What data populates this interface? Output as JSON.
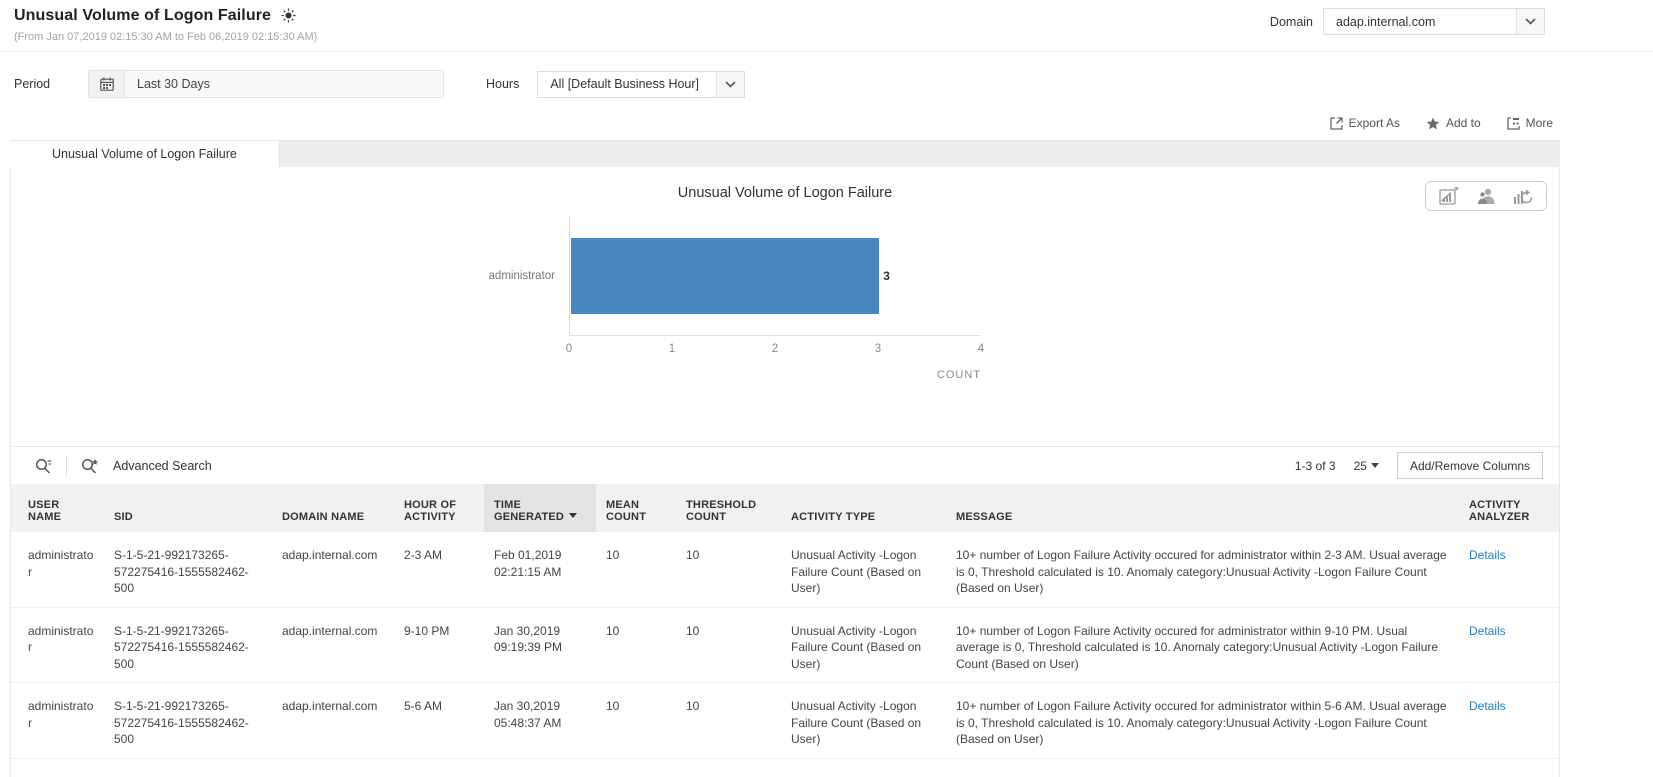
{
  "header": {
    "title": "Unusual Volume of Logon Failure",
    "subtitle": "(From Jan 07,2019 02:15:30 AM to Feb 06,2019 02:15:30 AM)",
    "domain_label": "Domain",
    "domain_value": "adap.internal.com"
  },
  "filters": {
    "period_label": "Period",
    "period_value": "Last 30 Days",
    "hours_label": "Hours",
    "hours_value": "All [Default Business Hour]"
  },
  "toolbar": {
    "export_label": "Export As",
    "add_to_label": "Add to",
    "more_label": "More"
  },
  "tabs": [
    {
      "label": "Unusual Volume of Logon Failure",
      "active": true
    }
  ],
  "chart_data": {
    "type": "bar",
    "orientation": "horizontal",
    "title": "Unusual Volume of Logon Failure",
    "categories": [
      "administrator"
    ],
    "values": [
      3
    ],
    "value_labels": [
      "3"
    ],
    "xlabel": "COUNT",
    "ylabel": "",
    "xlim": [
      0,
      4
    ],
    "xticks": [
      0,
      1,
      2,
      3,
      4
    ],
    "bar_color": "#4a86be",
    "legend": false,
    "grid": false
  },
  "table_toolbar": {
    "advanced_search_label": "Advanced Search",
    "pagination": "1-3 of 3",
    "page_size": "25",
    "add_remove_columns_label": "Add/Remove Columns"
  },
  "table": {
    "columns": [
      "USER NAME",
      "SID",
      "DOMAIN NAME",
      "HOUR OF ACTIVITY",
      "TIME GENERATED",
      "MEAN COUNT",
      "THRESHOLD COUNT",
      "ACTIVITY TYPE",
      "MESSAGE",
      "ACTIVITY ANALYZER"
    ],
    "sorted_column_index": 4,
    "sort_direction": "desc",
    "rows": [
      {
        "user_name": "administrator",
        "sid": "S-1-5-21-992173265-572275416-1555582462-500",
        "domain_name": "adap.internal.com",
        "hour_of_activity": "2-3 AM",
        "time_generated": "Feb 01,2019 02:21:15 AM",
        "mean_count": "10",
        "threshold_count": "10",
        "activity_type": "Unusual Activity -Logon Failure Count (Based on User)",
        "message": "10+ number of Logon Failure Activity occured for administrator within 2-3 AM. Usual average is 0, Threshold calculated is 10. Anomaly category:Unusual Activity -Logon Failure Count (Based on User)",
        "analyzer_link": "Details"
      },
      {
        "user_name": "administrator",
        "sid": "S-1-5-21-992173265-572275416-1555582462-500",
        "domain_name": "adap.internal.com",
        "hour_of_activity": "9-10 PM",
        "time_generated": "Jan 30,2019 09:19:39 PM",
        "mean_count": "10",
        "threshold_count": "10",
        "activity_type": "Unusual Activity -Logon Failure Count (Based on User)",
        "message": "10+ number of Logon Failure Activity occured for administrator within 9-10 PM. Usual average is 0, Threshold calculated is 10. Anomaly category:Unusual Activity -Logon Failure Count (Based on User)",
        "analyzer_link": "Details"
      },
      {
        "user_name": "administrator",
        "sid": "S-1-5-21-992173265-572275416-1555582462-500",
        "domain_name": "adap.internal.com",
        "hour_of_activity": "5-6 AM",
        "time_generated": "Jan 30,2019 05:48:37 AM",
        "mean_count": "10",
        "threshold_count": "10",
        "activity_type": "Unusual Activity -Logon Failure Count (Based on User)",
        "message": "10+ number of Logon Failure Activity occured for administrator within 5-6 AM. Usual average is 0, Threshold calculated is 10. Anomaly category:Unusual Activity -Logon Failure Count (Based on User)",
        "analyzer_link": "Details"
      }
    ]
  }
}
